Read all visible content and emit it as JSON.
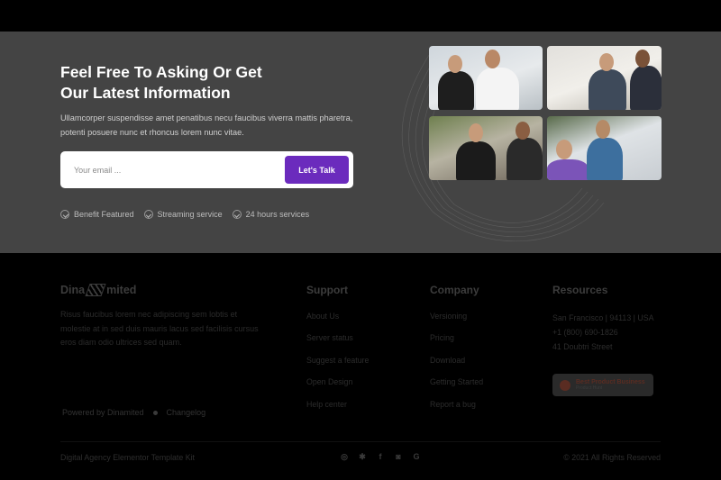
{
  "cta": {
    "title_line1": "Feel Free To Asking Or Get",
    "title_line2": "Our Latest Information",
    "description": "Ullamcorper suspendisse amet penatibus necu faucibus viverra mattis pharetra, potenti posuere nunc et rhoncus lorem nunc vitae.",
    "email_placeholder": "Your email ...",
    "button_label": "Let's Talk",
    "accent_color": "#6b2bbd",
    "features": [
      {
        "label": "Benefit Featured",
        "icon": "check-circle-icon"
      },
      {
        "label": "Streaming service",
        "icon": "check-circle-icon"
      },
      {
        "label": "24 hours services",
        "icon": "check-circle-icon"
      }
    ]
  },
  "footer": {
    "brand_left": "Dina",
    "brand_right": "mited",
    "brand_description": "Risus faucibus lorem nec adipiscing sem lobtis et molestie at in sed duis mauris lacus sed facilisis cursus eros diam odio ultrices sed quam.",
    "powered_by": "Powered by Dinamited",
    "changelog": "Changelog",
    "support": {
      "heading": "Support",
      "links": [
        "About Us",
        "Server status",
        "Suggest a feature",
        "Open Design",
        "Help center"
      ]
    },
    "company": {
      "heading": "Company",
      "links": [
        "Versioning",
        "Pricing",
        "Download",
        "Getting Started",
        "Report a bug"
      ]
    },
    "resources": {
      "heading": "Resources",
      "address": "San Francisco | 94113 | USA",
      "phone": "+1 (800) 690-1826",
      "street": "41 Doubtri Street",
      "badge_title": "Best Product Business",
      "badge_subtitle": "Product Hunt"
    },
    "bottom_left": "Digital Agency Elementor Template Kit",
    "bottom_right": "© 2021 All Rights Reserved",
    "socials": [
      "dribbble-icon",
      "bug-icon",
      "facebook-icon",
      "instagram-icon",
      "google-icon"
    ]
  }
}
